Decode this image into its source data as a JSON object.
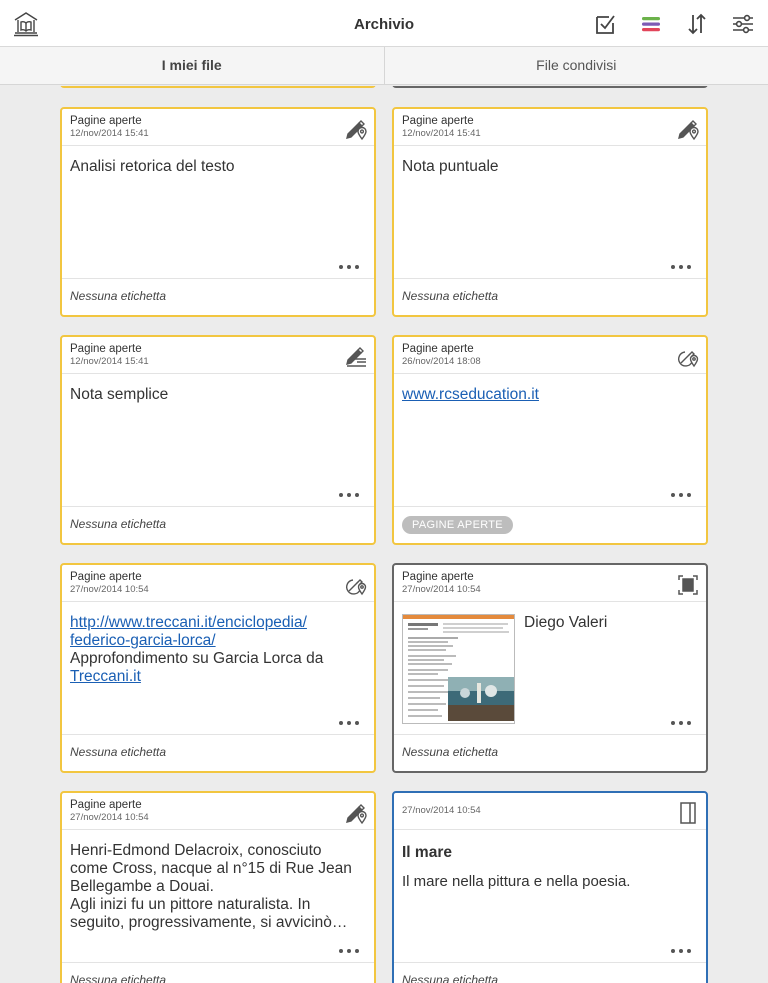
{
  "header": {
    "title": "Archivio"
  },
  "tabs": {
    "my_files": "I miei file",
    "shared_files": "File condivisi"
  },
  "cards": [
    {
      "source": "Pagine aperte",
      "date": "12/nov/2014 15:41",
      "icon": "pen-location-icon",
      "body": "Analisi retorica del testo",
      "footer": "Nessuna etichetta"
    },
    {
      "source": "Pagine aperte",
      "date": "12/nov/2014 15:41",
      "icon": "pen-location-icon",
      "body": "Nota puntuale",
      "footer": "Nessuna etichetta"
    },
    {
      "source": "Pagine aperte",
      "date": "12/nov/2014 15:41",
      "icon": "pen-lines-icon",
      "body": "Nota semplice",
      "footer": "Nessuna etichetta"
    },
    {
      "source": "Pagine aperte",
      "date": "26/nov/2014 18:08",
      "icon": "link-location-icon",
      "link": "www.rcseducation.it",
      "tag": "PAGINE APERTE"
    },
    {
      "source": "Pagine aperte",
      "date": "27/nov/2014 10:54",
      "icon": "link-location-icon",
      "link_line1": "http://www.treccani.it/enciclopedia/",
      "link_line2": "federico-garcia-lorca/",
      "text_line": "Approfondimento su Garcia Lorca da",
      "link_line3": "Treccani.it",
      "footer": "Nessuna etichetta"
    },
    {
      "source": "Pagine aperte",
      "date": "27/nov/2014 10:54",
      "icon": "screenshot-icon",
      "body": "Diego Valeri",
      "footer": "Nessuna etichetta"
    },
    {
      "source": "Pagine aperte",
      "date": "27/nov/2014 10:54",
      "icon": "pen-location-icon",
      "line1": "Henri-Edmond Delacroix, conosciuto",
      "line2": "come Cross, nacque al n°15 di Rue Jean",
      "line3": "Bellegambe a Douai.",
      "line4": "Agli inizi fu un pittore naturalista. In",
      "line5": "seguito, progressivamente, si avvicinò…",
      "footer": "Nessuna etichetta"
    },
    {
      "date": "27/nov/2014 10:54",
      "icon": "notebook-icon",
      "title": "Il mare",
      "body": "Il mare nella pittura e nella poesia.",
      "footer": "Nessuna etichetta"
    }
  ],
  "colors": {
    "highlight_border": "#f2c640",
    "photo_border": "#666666",
    "notebook_border": "#2f6fb5",
    "link": "#1a5fb4"
  }
}
